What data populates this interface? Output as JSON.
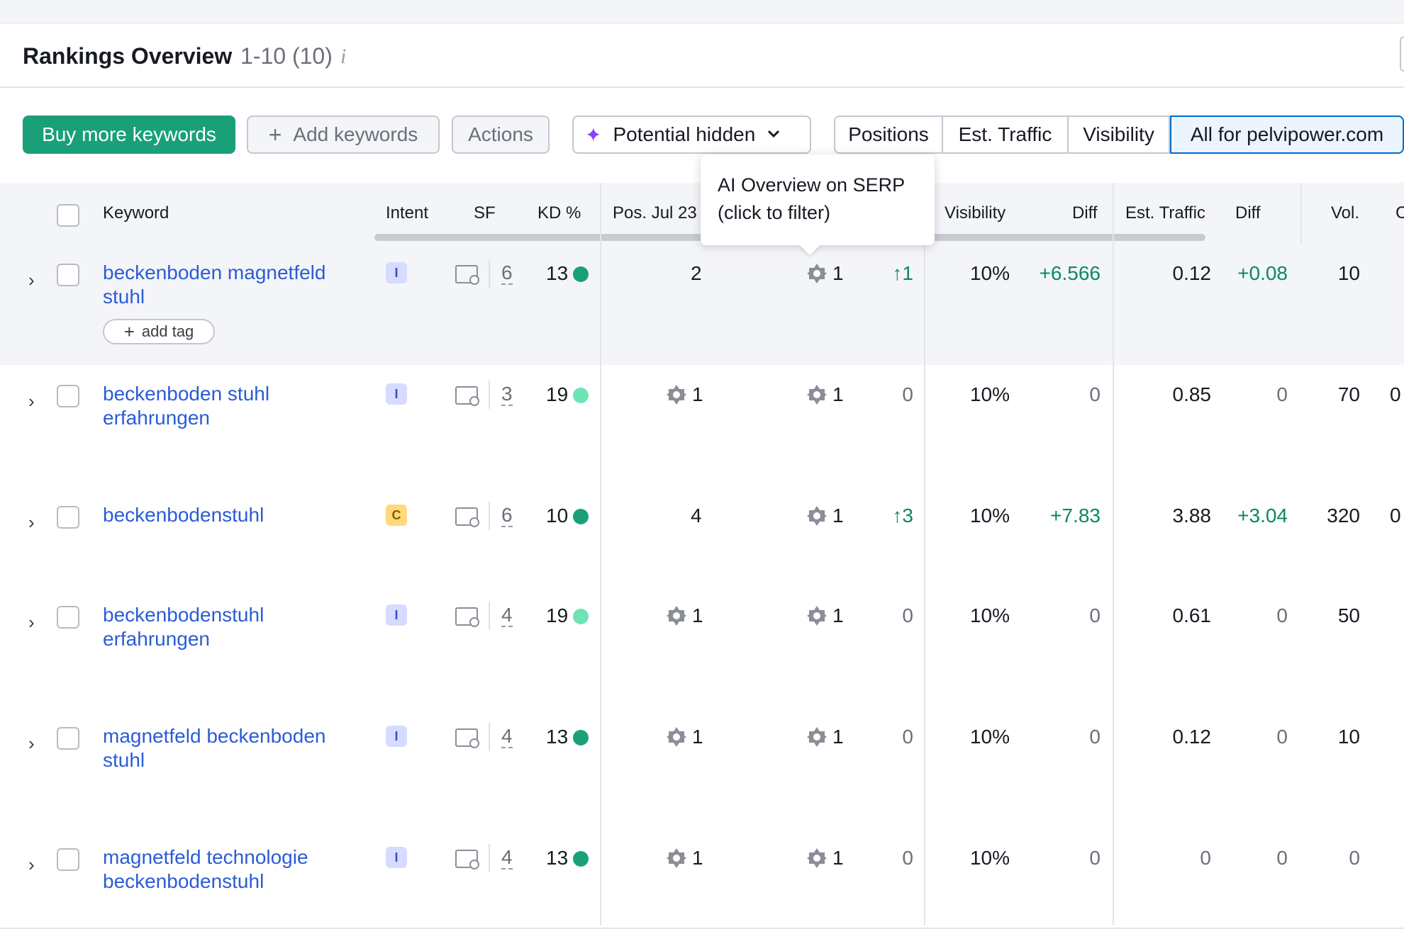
{
  "header": {
    "title": "Rankings Overview",
    "count": "1-10 (10)",
    "info_icon": "i"
  },
  "toolbar": {
    "buy_label": "Buy more keywords",
    "add_label": "Add keywords",
    "actions_label": "Actions",
    "potential_label": "Potential hidden",
    "tabs": [
      "Positions",
      "Est. Traffic",
      "Visibility",
      "All for pelvipower.com"
    ],
    "selected_tab": "All for pelvipower.com"
  },
  "tooltip": {
    "line1": "AI Overview on SERP",
    "line2": "(click to filter)"
  },
  "table": {
    "headers": {
      "keyword": "Keyword",
      "intent": "Intent",
      "sf": "SF",
      "kd": "KD %",
      "pos": "Pos. Jul 23",
      "visibility": "Visibility",
      "diff": "Diff",
      "traffic": "Est. Traffic",
      "diff2": "Diff",
      "vol": "Vol.",
      "cut": "C"
    },
    "add_tag_label": "add tag",
    "rows": [
      {
        "keyword": "beckenboden magnetfeld stuhl",
        "intent": "I",
        "sf": "6",
        "kd": "13",
        "kd_color": "#1aa079",
        "pos": "2",
        "pos_ai": false,
        "cur": "1",
        "change": "↑1",
        "vis": "10%",
        "vis_diff": "+6.566",
        "traffic": "0.12",
        "traffic_diff": "+0.08",
        "vol": "10",
        "cut": ""
      },
      {
        "keyword": "beckenboden stuhl erfahrungen",
        "intent": "I",
        "sf": "3",
        "kd": "19",
        "kd_color": "#6ee3b4",
        "pos": "1",
        "pos_ai": true,
        "cur": "1",
        "change": "0",
        "vis": "10%",
        "vis_diff": "0",
        "traffic": "0.85",
        "traffic_diff": "0",
        "vol": "70",
        "cut": "0"
      },
      {
        "keyword": "beckenbodenstuhl",
        "intent": "C",
        "sf": "6",
        "kd": "10",
        "kd_color": "#1aa079",
        "pos": "4",
        "pos_ai": false,
        "cur": "1",
        "change": "↑3",
        "vis": "10%",
        "vis_diff": "+7.83",
        "traffic": "3.88",
        "traffic_diff": "+3.04",
        "vol": "320",
        "cut": "0"
      },
      {
        "keyword": "beckenbodenstuhl erfahrungen",
        "intent": "I",
        "sf": "4",
        "kd": "19",
        "kd_color": "#6ee3b4",
        "pos": "1",
        "pos_ai": true,
        "cur": "1",
        "change": "0",
        "vis": "10%",
        "vis_diff": "0",
        "traffic": "0.61",
        "traffic_diff": "0",
        "vol": "50",
        "cut": ""
      },
      {
        "keyword": "magnetfeld beckenboden stuhl",
        "intent": "I",
        "sf": "4",
        "kd": "13",
        "kd_color": "#1aa079",
        "pos": "1",
        "pos_ai": true,
        "cur": "1",
        "change": "0",
        "vis": "10%",
        "vis_diff": "0",
        "traffic": "0.12",
        "traffic_diff": "0",
        "vol": "10",
        "cut": ""
      },
      {
        "keyword": "magnetfeld technologie beckenbodenstuhl",
        "intent": "I",
        "sf": "4",
        "kd": "13",
        "kd_color": "#1aa079",
        "pos": "1",
        "pos_ai": true,
        "cur": "1",
        "change": "0",
        "vis": "10%",
        "vis_diff": "0",
        "traffic": "0",
        "traffic_diff": "0",
        "vol": "0",
        "cut": ""
      }
    ]
  }
}
